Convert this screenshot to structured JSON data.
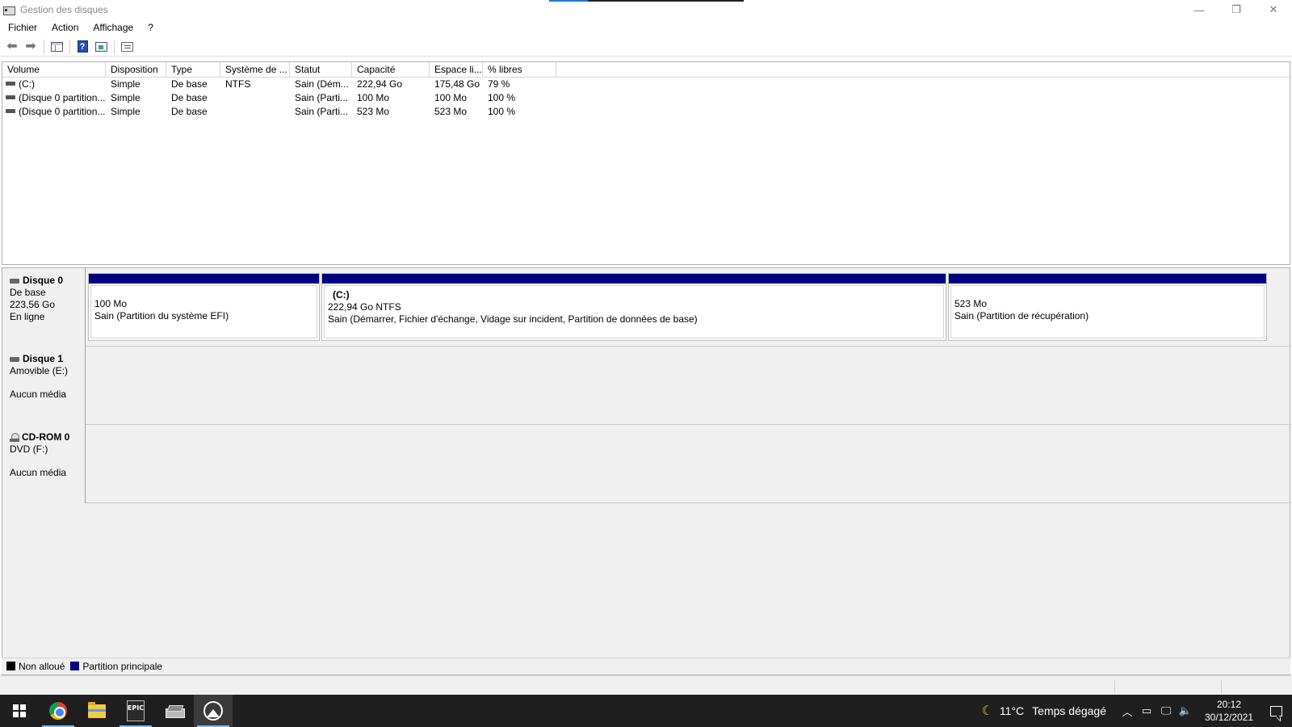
{
  "window": {
    "title": "Gestion des disques",
    "controls": {
      "minimize": "—",
      "restore": "❐",
      "close": "✕"
    }
  },
  "menu": [
    "Fichier",
    "Action",
    "Affichage",
    "?"
  ],
  "toolbar": {
    "icons": [
      "back-arrow-icon",
      "forward-arrow-icon",
      "console-tree-icon",
      "help-icon",
      "show-pane-icon",
      "properties-list-icon"
    ]
  },
  "volumes": {
    "headers": [
      "Volume",
      "Disposition",
      "Type",
      "Système de ...",
      "Statut",
      "Capacité",
      "Espace li...",
      "% libres"
    ],
    "rows": [
      [
        "(C:)",
        "Simple",
        "De base",
        "NTFS",
        "Sain (Dém...",
        "222,94 Go",
        "175,48 Go",
        "79 %"
      ],
      [
        "(Disque 0 partition...",
        "Simple",
        "De base",
        "",
        "Sain (Parti...",
        "100 Mo",
        "100 Mo",
        "100 %"
      ],
      [
        "(Disque 0 partition...",
        "Simple",
        "De base",
        "",
        "Sain (Parti...",
        "523 Mo",
        "523 Mo",
        "100 %"
      ]
    ]
  },
  "disks": [
    {
      "name": "Disque 0",
      "kind": "De base",
      "size": "223,56 Go",
      "state": "En ligne",
      "partitions": [
        {
          "name": "",
          "size": "100 Mo",
          "status": "Sain (Partition du système EFI)"
        },
        {
          "name": "(C:)",
          "size": "222,94 Go NTFS",
          "status": "Sain (Démarrer, Fichier d'échange, Vidage sur incident, Partition de données de base)"
        },
        {
          "name": "",
          "size": "523 Mo",
          "status": "Sain (Partition de récupération)"
        }
      ]
    },
    {
      "name": "Disque 1",
      "kind": "Amovible (E:)",
      "state": "Aucun média"
    },
    {
      "name": "CD-ROM 0",
      "kind": "DVD (F:)",
      "state": "Aucun média"
    }
  ],
  "legend": [
    {
      "label": "Non alloué",
      "color": "#000000"
    },
    {
      "label": "Partition principale",
      "color": "#000080"
    }
  ],
  "taskbar": {
    "apps": [
      "windows-start-icon",
      "chrome-icon",
      "file-explorer-icon",
      "epic-games-icon",
      "disk-management-icon",
      "mountain-app-icon"
    ],
    "epic_label": "EPIC",
    "weather": {
      "temp": "11°C",
      "text": "Temps dégagé"
    },
    "clock": {
      "time": "20:12",
      "date": "30/12/2021"
    }
  }
}
